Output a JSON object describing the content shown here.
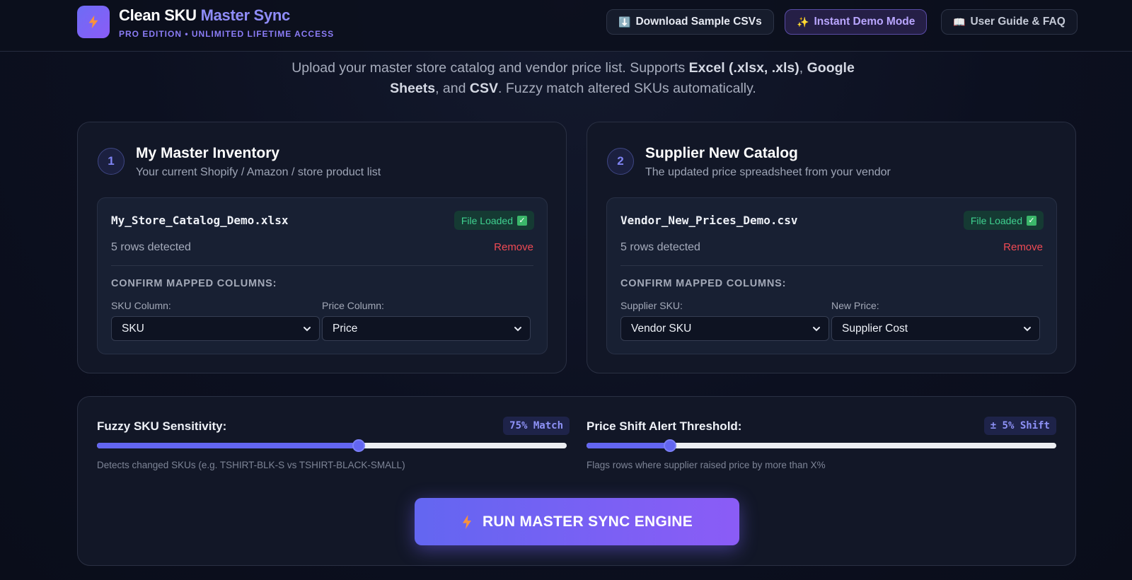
{
  "header": {
    "brand_part1": "Clean SKU",
    "brand_part2": "Master Sync",
    "edition": "PRO EDITION • UNLIMITED LIFETIME ACCESS",
    "logo_icon": "lightning-bolt-icon",
    "nav": {
      "download": {
        "icon": "⬇️",
        "label": "Download Sample CSVs"
      },
      "demo": {
        "icon": "✨",
        "label": "Instant Demo Mode"
      },
      "guide": {
        "icon": "📖",
        "label": "User Guide & FAQ"
      }
    }
  },
  "intro": {
    "t1": "Upload your master store catalog and vendor price list. Supports ",
    "b1": "Excel (.xlsx, .xls)",
    "t2": ", ",
    "b2": "Google Sheets",
    "t3": ", and ",
    "b3": "CSV",
    "t4": ". Fuzzy match altered SKUs automatically."
  },
  "master": {
    "step": "1",
    "title": "My Master Inventory",
    "subtitle": "Your current Shopify / Amazon / store product list",
    "filename": "My_Store_Catalog_Demo.xlsx",
    "status": "File Loaded",
    "rows": "5 rows detected",
    "remove": "Remove",
    "confirm": "CONFIRM MAPPED COLUMNS:",
    "sku_label": "SKU Column:",
    "sku_value": "SKU",
    "price_label": "Price Column:",
    "price_value": "Price"
  },
  "supplier": {
    "step": "2",
    "title": "Supplier New Catalog",
    "subtitle": "The updated price spreadsheet from your vendor",
    "filename": "Vendor_New_Prices_Demo.csv",
    "status": "File Loaded",
    "rows": "5 rows detected",
    "remove": "Remove",
    "confirm": "CONFIRM MAPPED COLUMNS:",
    "sku_label": "Supplier SKU:",
    "sku_value": "Vendor SKU",
    "price_label": "New Price:",
    "price_value": "Supplier Cost"
  },
  "settings": {
    "fuzzy": {
      "label": "Fuzzy SKU Sensitivity:",
      "badge": "75% Match",
      "value_fraction": 0.557,
      "help": "Detects changed SKUs (e.g. TSHIRT-BLK-S vs TSHIRT-BLACK-SMALL)"
    },
    "price": {
      "label": "Price Shift Alert Threshold:",
      "badge": "± 5% Shift",
      "value_fraction": 0.177,
      "help": "Flags rows where supplier raised price by more than X%"
    }
  },
  "run_button": "RUN MASTER SYNC ENGINE",
  "colors": {
    "accent": "#6366f1",
    "accent_purple": "#8b5cf6",
    "success": "#3fd08f",
    "danger": "#f04a54",
    "bolt": "#fb923c"
  }
}
